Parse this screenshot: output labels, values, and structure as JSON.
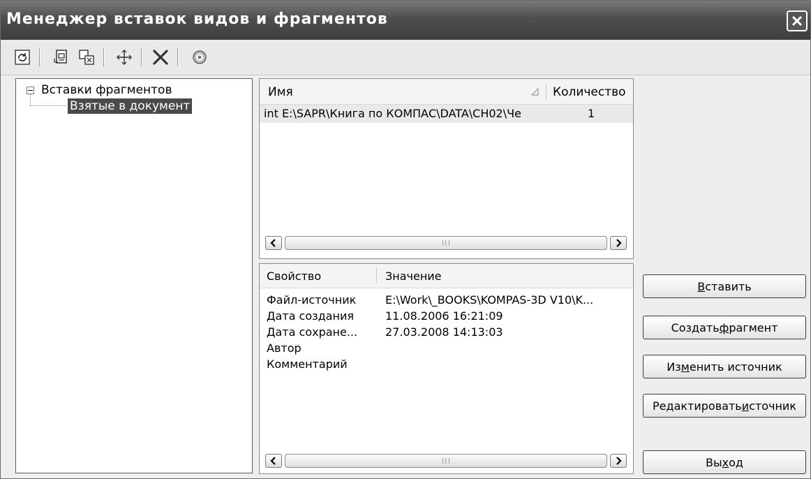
{
  "window": {
    "title": "Менеджер вставок видов и фрагментов"
  },
  "toolbar": {
    "buttons": [
      {
        "name": "refresh-icon"
      },
      {
        "name": "insert-fragment-icon"
      },
      {
        "name": "copy-fragment-icon"
      },
      {
        "name": "move-icon"
      },
      {
        "name": "delete-icon"
      },
      {
        "name": "help-icon"
      }
    ]
  },
  "tree": {
    "root_label": "Вставки фрагментов",
    "child_label": "Взятые в документ"
  },
  "list": {
    "col_name": "Имя",
    "col_count": "Количество",
    "rows": [
      {
        "name": "int E:\\SAPR\\Книга по КОМПАС\\DATA\\CH02\\Че",
        "count": "1"
      }
    ]
  },
  "props": {
    "col_property": "Свойство",
    "col_value": "Значение",
    "rows": [
      {
        "name": "Файл-источник",
        "value": "E:\\Work\\_BOOKS\\KOMPAS-3D V10\\K..."
      },
      {
        "name": "Дата создания",
        "value": "11.08.2006  16:21:09"
      },
      {
        "name": "Дата сохране...",
        "value": "27.03.2008  14:13:03"
      },
      {
        "name": "Автор",
        "value": ""
      },
      {
        "name": "Комментарий",
        "value": ""
      }
    ]
  },
  "buttons": {
    "insert": {
      "pre": "",
      "acc": "В",
      "post": "ставить"
    },
    "create_fragment": {
      "pre": "Создать ",
      "acc": "ф",
      "post": "рагмент"
    },
    "change_source": {
      "pre": "Из",
      "acc": "м",
      "post": "енить источник"
    },
    "edit_source": {
      "pre": "Редактировать ",
      "acc": "и",
      "post": "сточник"
    },
    "exit": {
      "pre": "Вы",
      "acc": "х",
      "post": "од"
    }
  }
}
